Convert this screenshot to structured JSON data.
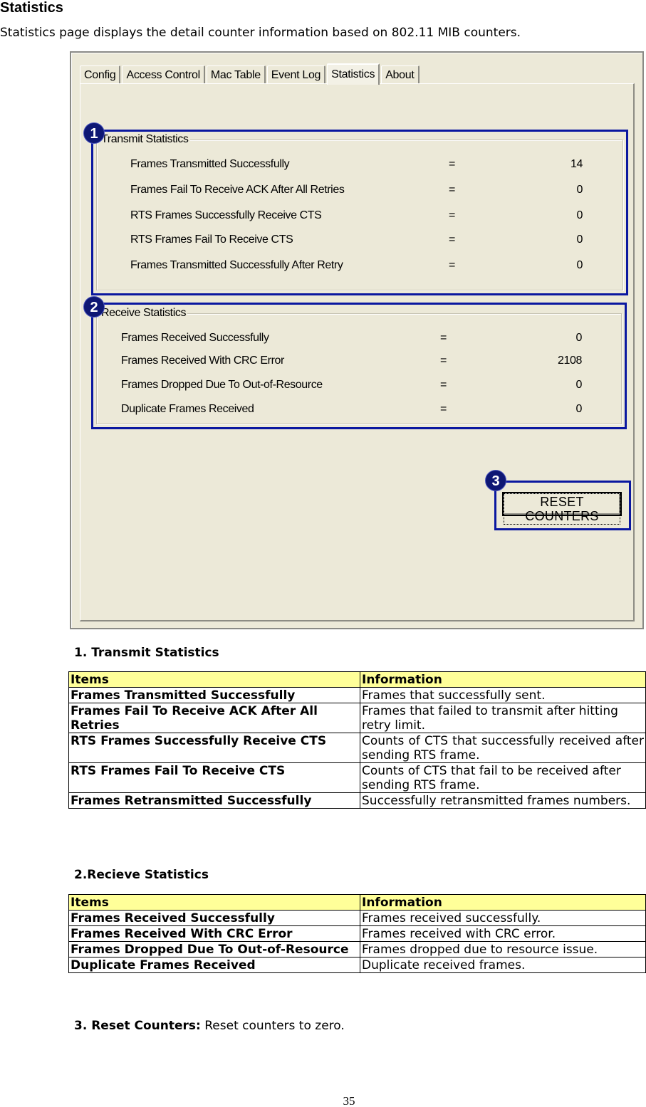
{
  "page": {
    "title": "Statistics",
    "intro": "Statistics page displays the detail counter information based on 802.11 MIB counters.",
    "page_number": "35"
  },
  "dialog": {
    "tabs": [
      {
        "label": "Config",
        "active": false
      },
      {
        "label": "Access Control",
        "active": false
      },
      {
        "label": "Mac Table",
        "active": false
      },
      {
        "label": "Event Log",
        "active": false
      },
      {
        "label": "Statistics",
        "active": true
      },
      {
        "label": "About",
        "active": false
      }
    ],
    "callouts": [
      "1",
      "2",
      "3"
    ],
    "highlight_color": "#0A17A0",
    "transmit": {
      "title": "Transmit Statistics",
      "rows": [
        {
          "label": "Frames Transmitted Successfully",
          "eq": "=",
          "value": "14"
        },
        {
          "label": "Frames Fail To Receive ACK After All Retries",
          "eq": "=",
          "value": "0"
        },
        {
          "label": "RTS Frames Successfully Receive CTS",
          "eq": "=",
          "value": "0"
        },
        {
          "label": "RTS Frames Fail To Receive CTS",
          "eq": "=",
          "value": "0"
        },
        {
          "label": "Frames Transmitted Successfully After Retry",
          "eq": "=",
          "value": "0"
        }
      ]
    },
    "receive": {
      "title": "Receive Statistics",
      "rows": [
        {
          "label": "Frames Received Successfully",
          "eq": "=",
          "value": "0"
        },
        {
          "label": "Frames Received With CRC Error",
          "eq": "=",
          "value": "2108"
        },
        {
          "label": "Frames Dropped Due To Out-of-Resource",
          "eq": "=",
          "value": "0"
        },
        {
          "label": "Duplicate Frames Received",
          "eq": "=",
          "value": "0"
        }
      ]
    },
    "reset_button": "RESET COUNTERS"
  },
  "sections": {
    "transmit": {
      "heading": "1. Transmit Statistics",
      "headers": [
        "Items",
        "Information"
      ],
      "rows": [
        {
          "item": "Frames Transmitted Successfully",
          "info": "Frames that successfully sent."
        },
        {
          "item": "Frames Fail To Receive ACK After All Retries",
          "info": "Frames that failed to transmit after hitting retry limit."
        },
        {
          "item": "RTS Frames Successfully Receive CTS",
          "info": "Counts of CTS that successfully received after sending RTS frame."
        },
        {
          "item": "RTS Frames Fail To Receive CTS",
          "info": "Counts of CTS that fail to be received after sending RTS frame."
        },
        {
          "item": "Frames Retransmitted Successfully",
          "info": "Successfully retransmitted frames numbers."
        }
      ]
    },
    "receive": {
      "heading": "2.Recieve Statistics",
      "headers": [
        "Items",
        "Information"
      ],
      "rows": [
        {
          "item": "Frames Received Successfully",
          "info": "Frames received successfully."
        },
        {
          "item": "Frames Received With CRC Error",
          "info": "Frames received with CRC error."
        },
        {
          "item": "Frames Dropped Due To Out-of-Resource",
          "info": "Frames dropped due to resource issue."
        },
        {
          "item": "Duplicate Frames Received",
          "info": "Duplicate received frames."
        }
      ]
    },
    "reset": {
      "label": "3. Reset Counters:",
      "text": " Reset counters to zero."
    }
  },
  "colors": {
    "table_header_bg": "#FFFF99",
    "dialog_bg": "#ECE9D8",
    "callout_bg": "#0E1774"
  }
}
